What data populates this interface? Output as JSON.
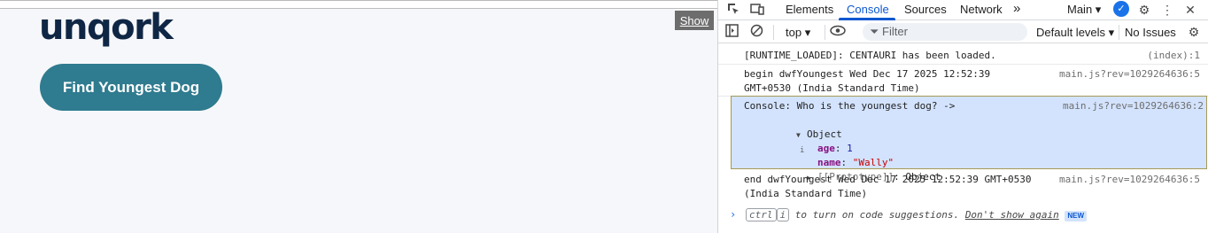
{
  "app": {
    "logo_text": "unqork",
    "find_button_label": "Find Youngest Dog",
    "show_tab_label": "Show"
  },
  "devtools": {
    "tabs": [
      {
        "label": "Elements"
      },
      {
        "label": "Console"
      },
      {
        "label": "Sources"
      },
      {
        "label": "Network"
      }
    ],
    "more_tabs": "»",
    "target_selector": "Main",
    "toolbar": {
      "context": "top",
      "filter_placeholder": "Filter",
      "levels": "Default levels",
      "issues": "No Issues"
    },
    "console": {
      "messages": [
        {
          "text": "[RUNTIME_LOADED]: CENTAURI has been loaded.",
          "source": "(index):1"
        },
        {
          "text": "begin dwfYoungest Wed Dec 17 2025 12:52:39\nGMT+0530 (India Standard Time)",
          "source": "main.js?rev=1029264636:5"
        },
        {
          "text": "Console: Who is the youngest dog? ->",
          "source": "main.js?rev=1029264636:2"
        },
        {
          "text": "end dwfYoungest Wed Dec 17 2025 12:52:39 GMT+0530\n(India Standard Time)",
          "source": "main.js?rev=1029264636:5"
        }
      ],
      "object": {
        "label": "Object",
        "info_icon": "i",
        "age_key": "age",
        "age_value": "1",
        "name_key": "name",
        "name_value": "\"Wally\"",
        "prototype_key": "[[Prototype]]",
        "prototype_value": "Object"
      },
      "hint": {
        "ctrl": "ctrl",
        "i": "i",
        "text": " to turn on code suggestions. ",
        "dont_show": "Don't show again",
        "new": "NEW"
      }
    }
  }
}
